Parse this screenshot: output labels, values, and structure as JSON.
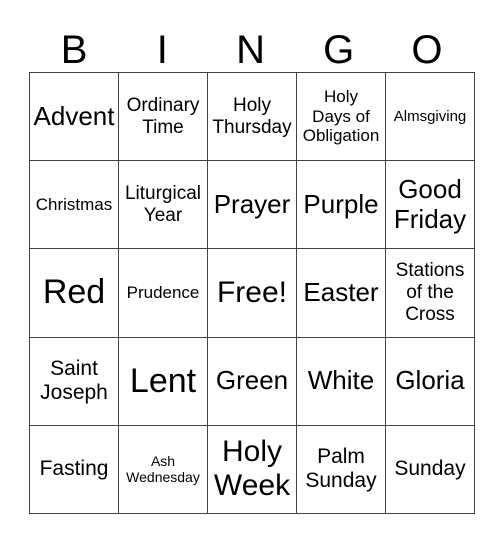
{
  "header": [
    "B",
    "I",
    "N",
    "G",
    "O"
  ],
  "rows": [
    [
      "Advent",
      "Ordinary\nTime",
      "Holy\nThursday",
      "Holy\nDays of\nObligation",
      "Almsgiving"
    ],
    [
      "Christmas",
      "Liturgical\nYear",
      "Prayer",
      "Purple",
      "Good\nFriday"
    ],
    [
      "Red",
      "Prudence",
      "Free!",
      "Easter",
      "Stations\nof the\nCross"
    ],
    [
      "Saint\nJoseph",
      "Lent",
      "Green",
      "White",
      "Gloria"
    ],
    [
      "Fasting",
      "Ash\nWednesday",
      "Holy\nWeek",
      "Palm\nSunday",
      "Sunday"
    ]
  ]
}
